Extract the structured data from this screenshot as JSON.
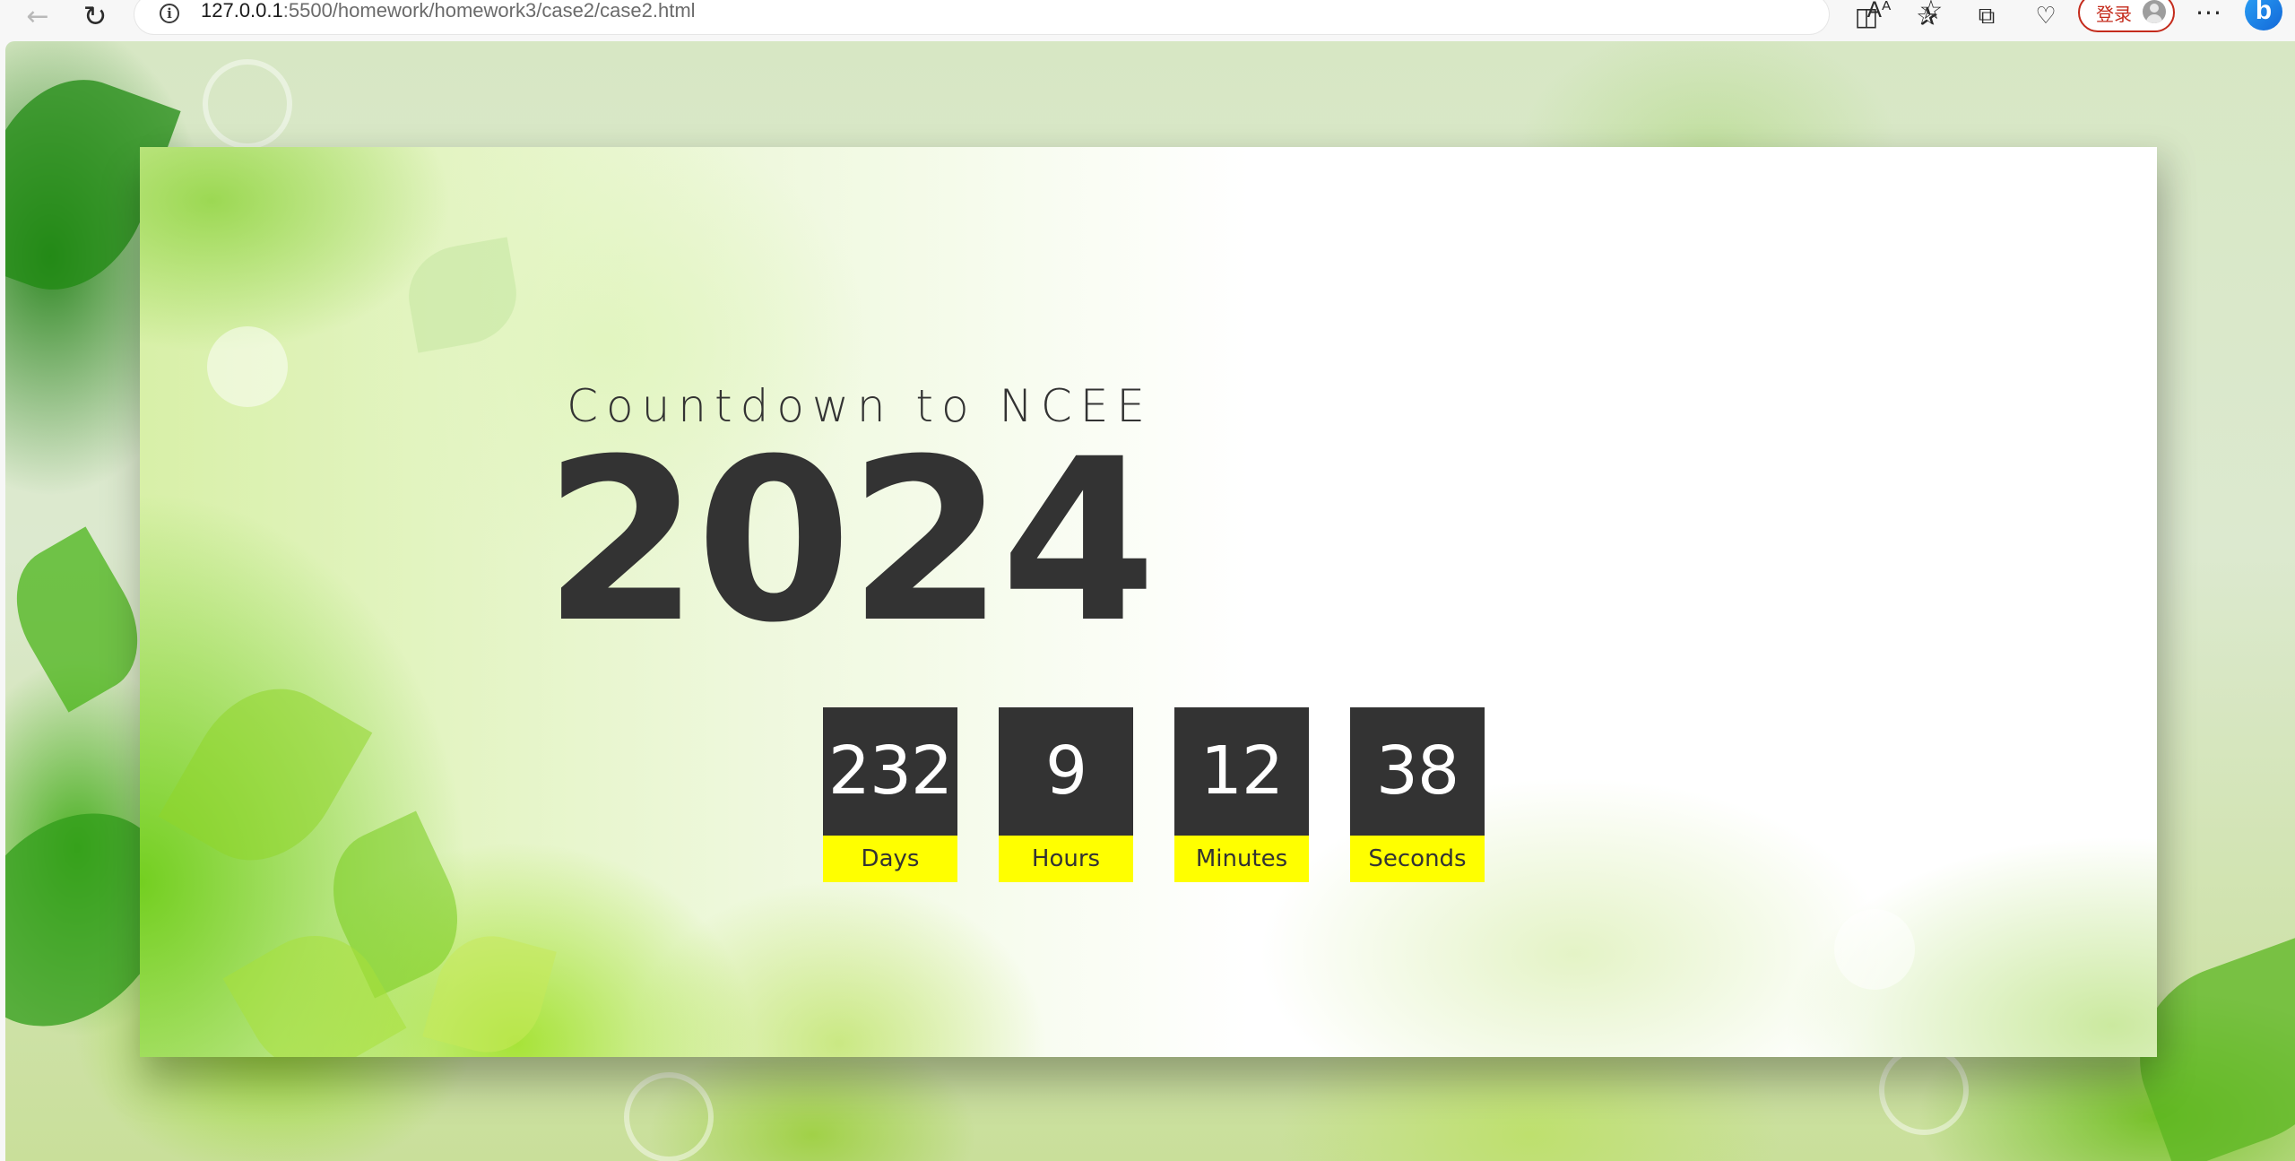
{
  "browser": {
    "url_host": "127.0.0.1",
    "url_path": ":5500/homework/homework3/case2/case2.html",
    "login_label": "登录"
  },
  "page": {
    "subtitle": "Countdown to NCEE",
    "year": "2024",
    "countdown": [
      {
        "value": "232",
        "label": "Days"
      },
      {
        "value": "9",
        "label": "Hours"
      },
      {
        "value": "12",
        "label": "Minutes"
      },
      {
        "value": "38",
        "label": "Seconds"
      }
    ],
    "colors": {
      "dark": "#333333",
      "label_bg": "#ffff00",
      "text_light": "#ffffff"
    }
  }
}
